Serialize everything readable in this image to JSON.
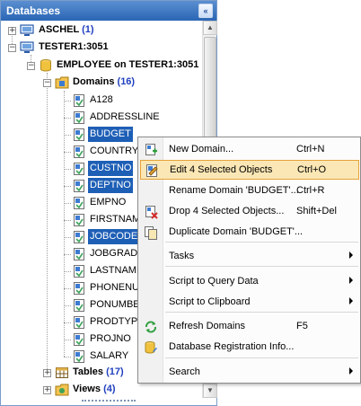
{
  "panel": {
    "title": "Databases",
    "chevron_glyph": "«"
  },
  "tree": {
    "hosts": [
      {
        "name": "ASCHEL",
        "count": "(1)"
      },
      {
        "name": "TESTER1:3051"
      }
    ],
    "database": "EMPLOYEE on TESTER1:3051",
    "domains_group": {
      "label": "Domains",
      "count": "(16)"
    },
    "domains": [
      "A128",
      "ADDRESSLINE",
      "BUDGET",
      "COUNTRYNAME",
      "CUSTNO",
      "DEPTNO",
      "EMPNO",
      "FIRSTNAME",
      "JOBCODE",
      "JOBGRADE",
      "LASTNAME",
      "PHONENUMBER",
      "PONUMBER",
      "PRODTYPE",
      "PROJNO",
      "SALARY"
    ],
    "selected_domains": [
      "BUDGET",
      "CUSTNO",
      "DEPTNO",
      "JOBCODE"
    ],
    "tables_group": {
      "label": "Tables",
      "count": "(17)"
    },
    "views_group": {
      "label": "Views",
      "count": "(4)"
    }
  },
  "context_menu": {
    "items": [
      {
        "label": "New Domain...",
        "shortcut": "Ctrl+N",
        "icon": "new-domain-icon"
      },
      {
        "label": "Edit 4 Selected Objects",
        "shortcut": "Ctrl+O",
        "icon": "edit-objects-icon",
        "highlighted": true
      },
      {
        "label": "Rename Domain 'BUDGET'...",
        "shortcut": "Ctrl+R"
      },
      {
        "label": "Drop 4 Selected Objects...",
        "shortcut": "Shift+Del",
        "icon": "drop-objects-icon"
      },
      {
        "label": "Duplicate Domain 'BUDGET'...",
        "icon": "duplicate-icon"
      },
      {
        "label": "Tasks",
        "submenu": true
      },
      {
        "label": "Script to Query Data",
        "submenu": true
      },
      {
        "label": "Script to Clipboard",
        "submenu": true
      },
      {
        "label": "Refresh Domains",
        "shortcut": "F5",
        "icon": "refresh-icon"
      },
      {
        "label": "Database Registration Info...",
        "icon": "database-info-icon"
      },
      {
        "label": "Search",
        "submenu": true
      }
    ]
  },
  "colors": {
    "header": "#2a66b5",
    "selection": "#1e5fb6",
    "menu_highlight": "#fbe7b5",
    "count": "#2040c0"
  }
}
